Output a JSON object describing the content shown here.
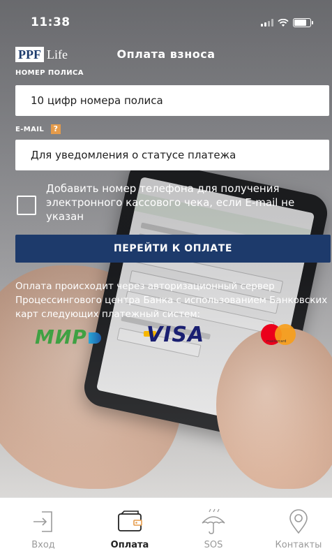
{
  "status_bar": {
    "time": "11:38"
  },
  "header": {
    "logo_ppf": "PPF",
    "logo_life": "Life",
    "title": "Оплата взноса"
  },
  "form": {
    "policy_label": "НОМЕР ПОЛИСА",
    "policy_placeholder": "10 цифр номера полиса",
    "email_label": "E-MAIL",
    "email_help": "?",
    "email_placeholder": "Для уведомления о статусе платежа",
    "phone_checkbox_label": "Добавить номер телефона для получения электронного кассового чека, если E-mail не указан",
    "phone_checkbox_checked": false,
    "pay_button": "ПЕРЕЙТИ К ОПЛАТЕ"
  },
  "info": {
    "text": "Оплата происходит через авторизационный сервер Процессингового центра Банка с использованием Банковских карт следующих платежный систем:"
  },
  "payment_systems": {
    "mir": "МИР",
    "visa": "VISA",
    "mastercard": "mastercard"
  },
  "tabbar": {
    "items": [
      {
        "label": "Вход",
        "icon": "login-icon",
        "active": false
      },
      {
        "label": "Оплата",
        "icon": "wallet-icon",
        "active": true
      },
      {
        "label": "SOS",
        "icon": "umbrella-icon",
        "active": false
      },
      {
        "label": "Контакты",
        "icon": "location-pin-icon",
        "active": false
      }
    ]
  }
}
